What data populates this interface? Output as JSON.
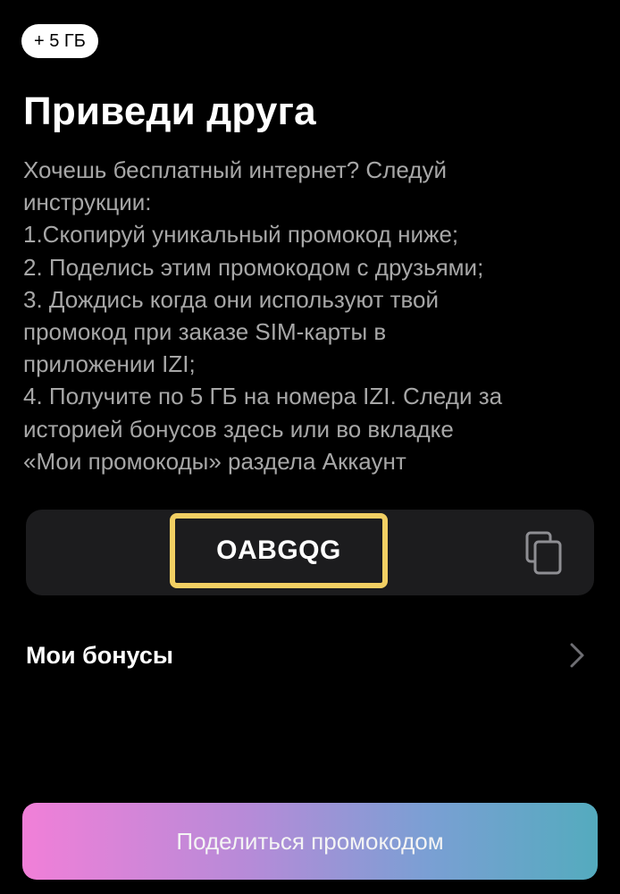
{
  "bonus_badge": "+ 5 ГБ",
  "title": "Приведи друга",
  "description_lines": [
    "Хочешь бесплатный интернет? Следуй",
    "инструкции:",
    "1.Скопируй уникальный промокод ниже;",
    "2. Поделись этим промокодом с друзьями;",
    "3. Дождись когда они используют твой",
    "промокод при заказе SIM-карты в",
    "приложении IZI;",
    "4. Получите по 5 ГБ на номера IZI. Следи за",
    "историей бонусов здесь или во вкладке",
    "«Мои промокоды» раздела Аккаунт"
  ],
  "promo": {
    "code": "OABGQG",
    "copy_icon": "copy-icon",
    "highlight_color": "#f2cf63"
  },
  "bonuses": {
    "label": "Мои бонусы",
    "icon": "chevron-right-icon"
  },
  "share_button": {
    "label": "Поделиться промокодом"
  },
  "colors": {
    "background": "#000000",
    "text_secondary": "#a7a7a7",
    "card": "#1c1c1e",
    "gradient_start": "#f17fd8",
    "gradient_end": "#54abbe"
  }
}
